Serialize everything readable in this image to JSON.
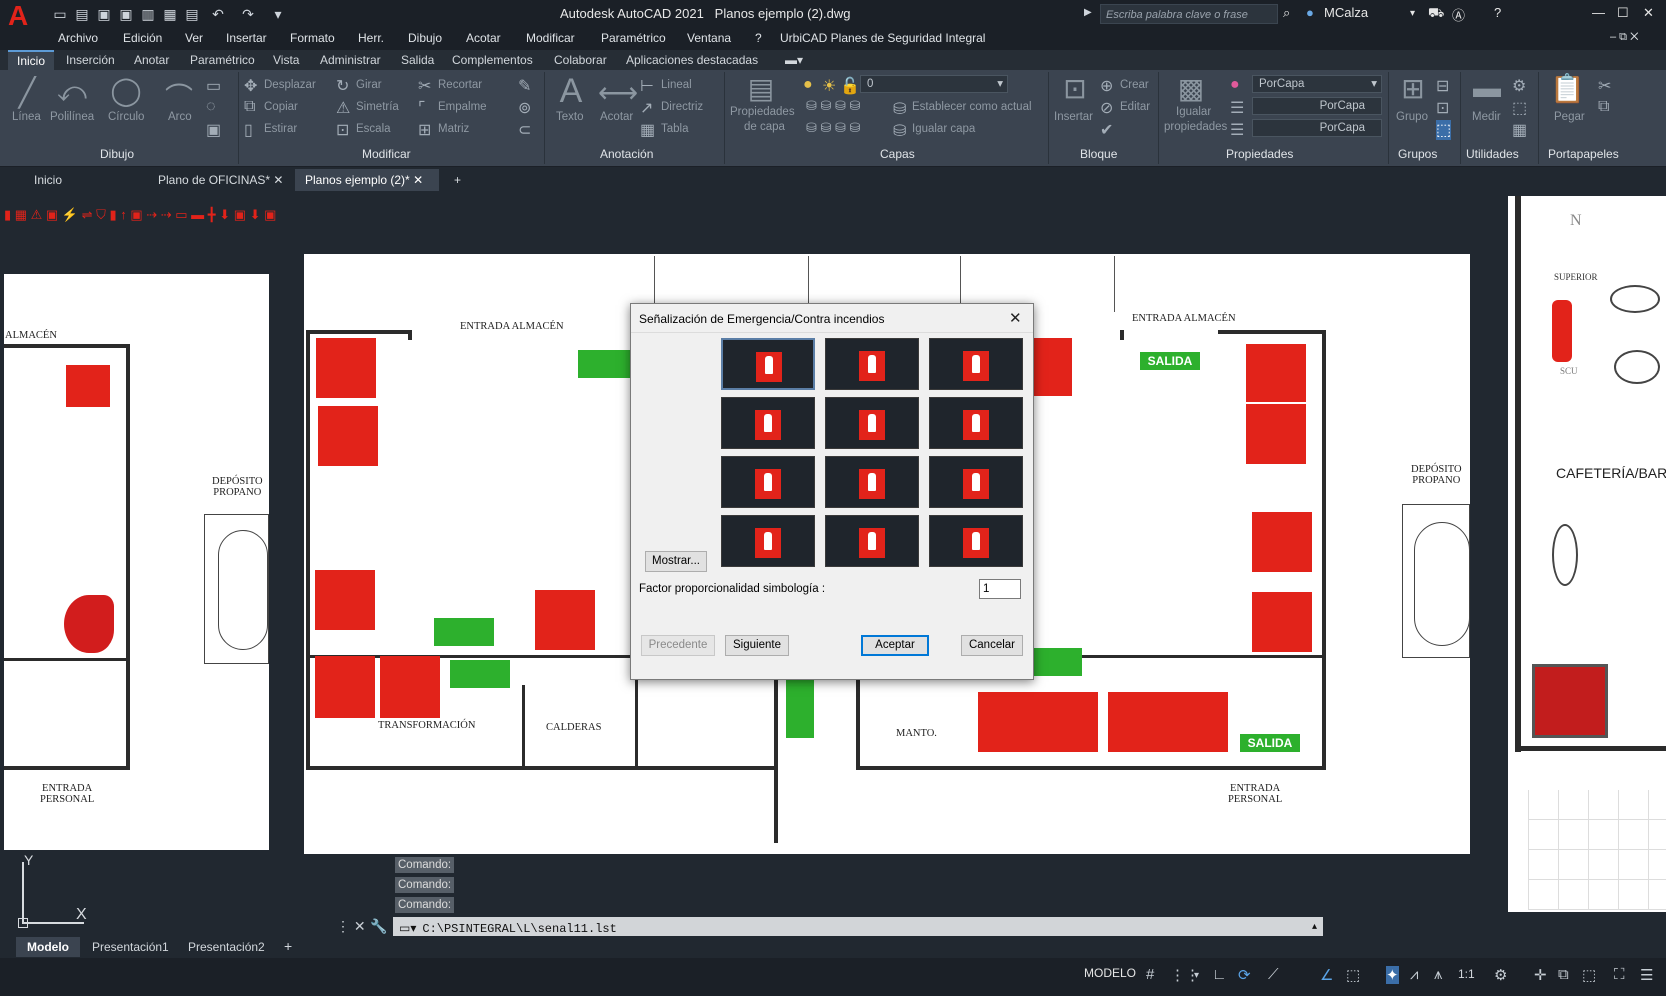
{
  "app": {
    "title": "Autodesk AutoCAD 2021",
    "file": "Planos ejemplo (2).dwg",
    "search_placeholder": "Escriba palabra clave o frase",
    "user": "MCalza",
    "logo": "A"
  },
  "menu": [
    "Archivo",
    "Edición",
    "Ver",
    "Insertar",
    "Formato",
    "Herr.",
    "Dibujo",
    "Acotar",
    "Modificar",
    "Paramétrico",
    "Ventana",
    "?",
    "UrbiCAD Planes de Seguridad Integral"
  ],
  "ribbon_tabs": [
    "Inicio",
    "Inserción",
    "Anotar",
    "Paramétrico",
    "Vista",
    "Administrar",
    "Salida",
    "Complementos",
    "Colaborar",
    "Aplicaciones destacadas"
  ],
  "ribbon": {
    "dibujo": {
      "linea": "Línea",
      "polilinea": "Polilínea",
      "circulo": "Círculo",
      "arco": "Arco",
      "panel": "Dibujo"
    },
    "modificar": {
      "desplazar": "Desplazar",
      "girar": "Girar",
      "recortar": "Recortar",
      "copiar": "Copiar",
      "simetria": "Simetría",
      "empalme": "Empalme",
      "estirar": "Estirar",
      "escala": "Escala",
      "matriz": "Matriz",
      "panel": "Modificar"
    },
    "anotacion": {
      "texto": "Texto",
      "acotar": "Acotar",
      "lineal": "Lineal",
      "directriz": "Directriz",
      "tabla": "Tabla",
      "panel": "Anotación"
    },
    "capas": {
      "propiedades1": "Propiedades",
      "propiedades2": "de capa",
      "layer_value": "0",
      "establecer": "Establecer como actual",
      "igualar": "Igualar capa",
      "panel": "Capas"
    },
    "bloque": {
      "insertar": "Insertar",
      "crear": "Crear",
      "editar": "Editar",
      "panel": "Bloque"
    },
    "propiedades": {
      "igualar1": "Igualar",
      "igualar2": "propiedades",
      "porcapa": "PorCapa",
      "panel": "Propiedades"
    },
    "grupos": {
      "grupo": "Grupo",
      "panel": "Grupos"
    },
    "utilidades": {
      "medir": "Medir",
      "panel": "Utilidades"
    },
    "portapapeles": {
      "pegar": "Pegar",
      "panel": "Portapapeles"
    }
  },
  "doc_tabs": [
    "Inicio",
    "Plano de OFICINAS*",
    "Planos ejemplo (2)*"
  ],
  "drawing_labels": {
    "almacen_left": "ALMACÉN",
    "deposito": [
      "DEPÓSITO",
      "PROPANO"
    ],
    "entrada_personal": [
      "ENTRADA",
      "PERSONAL"
    ],
    "entrada_almacen": "ENTRADA ALMACÉN",
    "transformacion": "TRANSFORMACIÓN",
    "calderas": "CALDERAS",
    "manto": "MANTO.",
    "salida": "SALIDA",
    "cafeteria": "CAFETERÍA/BAR",
    "superior": "SUPERIOR",
    "scu": "SCU",
    "north": "N"
  },
  "dialog": {
    "title": "Señalización de Emergencia/Contra incendios",
    "mostrar": "Mostrar...",
    "factor_label": "Factor proporcionalidad simbología :",
    "factor_value": "1",
    "precedente": "Precedente",
    "siguiente": "Siguiente",
    "aceptar": "Aceptar",
    "cancelar": "Cancelar"
  },
  "command": {
    "history": [
      "Comando:",
      "Comando:",
      "Comando:"
    ],
    "input": "C:\\PSINTEGRAL\\L\\senal11.lst"
  },
  "layout_tabs": [
    "Modelo",
    "Presentación1",
    "Presentación2"
  ],
  "status": {
    "mode": "MODELO",
    "scale": "1:1"
  },
  "ucs": {
    "x": "X",
    "y": "Y"
  }
}
